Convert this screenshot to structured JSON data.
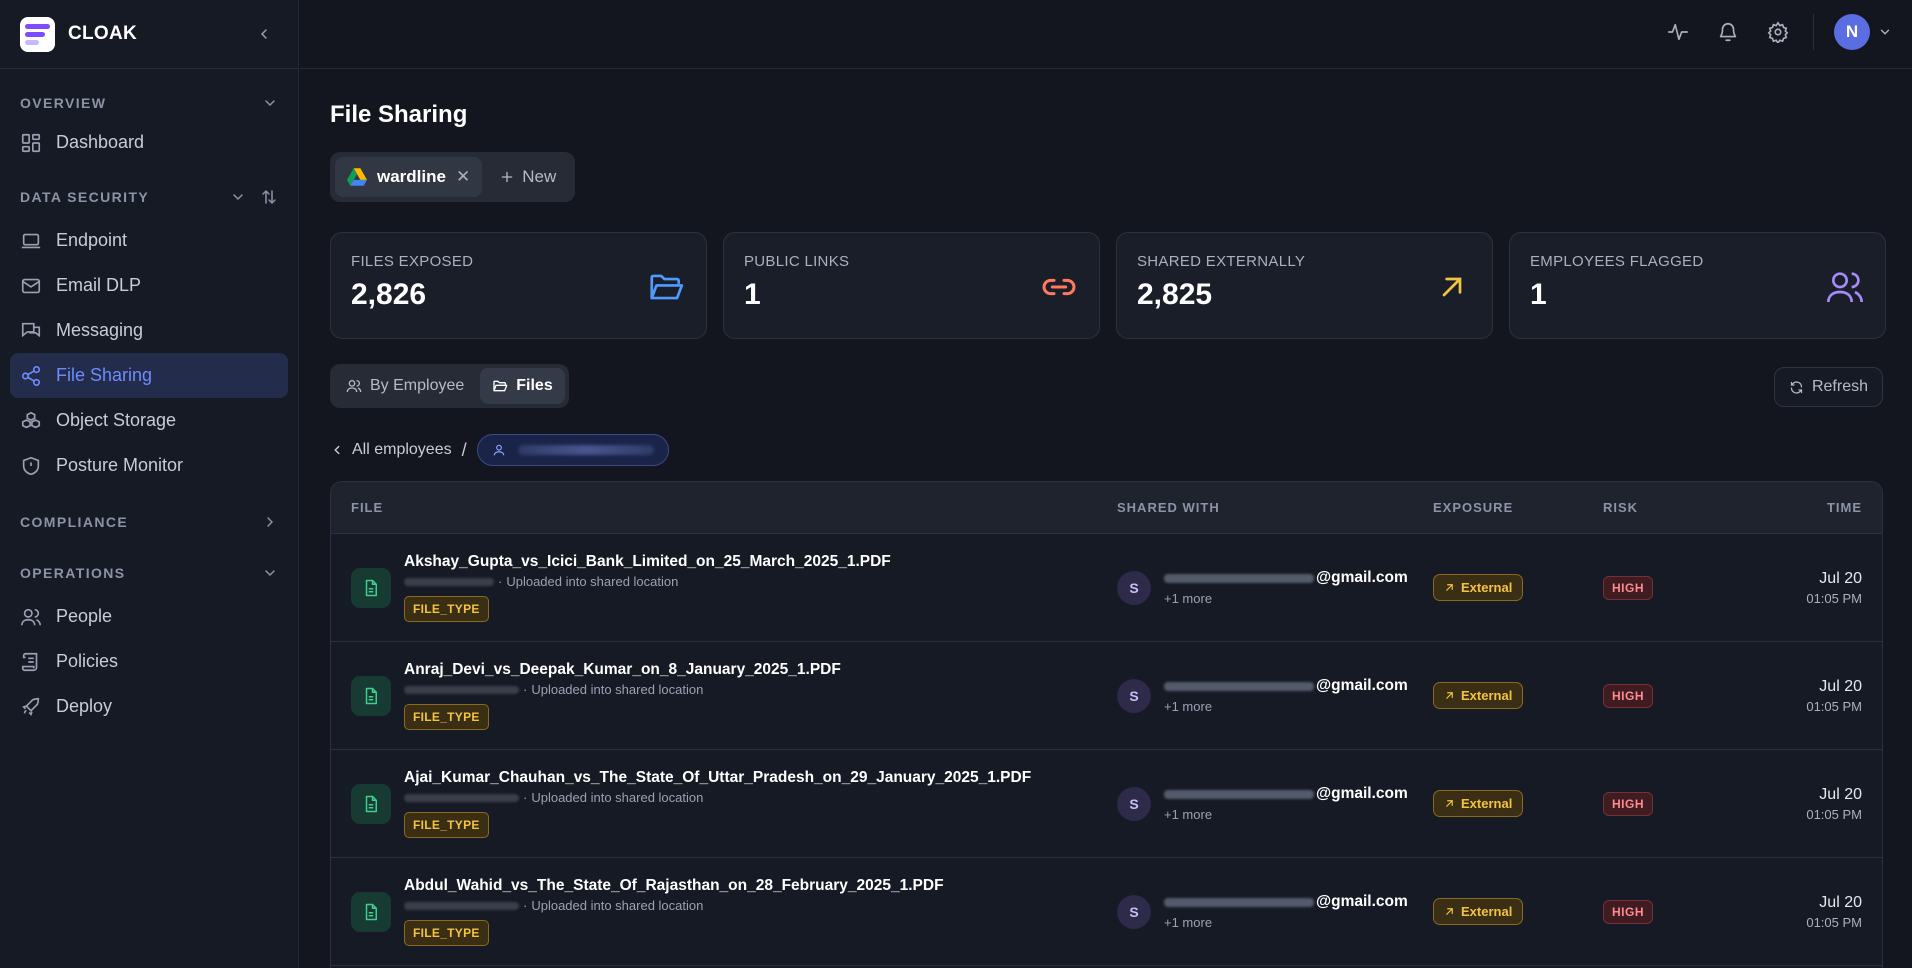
{
  "brand": {
    "name": "CLOAK"
  },
  "colors": {
    "accent": "#6d8bff",
    "background": "#13161f",
    "sidebar": "#161a24",
    "warning": "#f5c342",
    "danger": "#ff8a8f",
    "success": "#3ecf8e"
  },
  "sidebar": {
    "sections": [
      {
        "title": "OVERVIEW",
        "items": [
          {
            "label": "Dashboard",
            "icon": "dashboard-icon"
          }
        ]
      },
      {
        "title": "DATA SECURITY",
        "items": [
          {
            "label": "Endpoint",
            "icon": "laptop-icon"
          },
          {
            "label": "Email DLP",
            "icon": "mail-icon"
          },
          {
            "label": "Messaging",
            "icon": "messages-icon"
          },
          {
            "label": "File Sharing",
            "icon": "share-icon",
            "active": true
          },
          {
            "label": "Object Storage",
            "icon": "boxes-icon"
          },
          {
            "label": "Posture Monitor",
            "icon": "shield-icon"
          }
        ]
      },
      {
        "title": "COMPLIANCE",
        "items": []
      },
      {
        "title": "OPERATIONS",
        "items": [
          {
            "label": "People",
            "icon": "users-icon"
          },
          {
            "label": "Policies",
            "icon": "scroll-icon"
          },
          {
            "label": "Deploy",
            "icon": "rocket-icon"
          }
        ]
      }
    ]
  },
  "topbar": {
    "avatar_initial": "N"
  },
  "page": {
    "title": "File Sharing",
    "workspace": {
      "name": "wardline",
      "close": "✕",
      "new_label": "New"
    }
  },
  "stats": [
    {
      "label": "FILES EXPOSED",
      "value": "2,826",
      "icon": "folder-open-icon",
      "color": "#4f9bff"
    },
    {
      "label": "PUBLIC LINKS",
      "value": "1",
      "icon": "link-icon",
      "color": "#ff7a5c"
    },
    {
      "label": "SHARED EXTERNALLY",
      "value": "2,825",
      "icon": "arrow-up-right-icon",
      "color": "#f5c342"
    },
    {
      "label": "EMPLOYEES FLAGGED",
      "value": "1",
      "icon": "users-icon",
      "color": "#a78bfa"
    }
  ],
  "view_toggle": {
    "by_employee": "By Employee",
    "files": "Files",
    "active": "Files"
  },
  "refresh_label": "Refresh",
  "breadcrumb": {
    "back_label": "All employees",
    "separator": "/"
  },
  "table": {
    "columns": {
      "file": "FILE",
      "shared_with": "SHARED WITH",
      "exposure": "EXPOSURE",
      "risk": "RISK",
      "time": "TIME"
    },
    "rows": [
      {
        "file": "Akshay_Gupta_vs_Icici_Bank_Limited_on_25_March_2025_1.PDF",
        "action": "Uploaded into shared location",
        "type": "FILE_TYPE",
        "avatar": "S",
        "email_domain": "@gmail.com",
        "more": "+1 more",
        "exposure": "External",
        "risk": "HIGH",
        "date": "Jul 20",
        "time": "01:05 PM"
      },
      {
        "file": "Anraj_Devi_vs_Deepak_Kumar_on_8_January_2025_1.PDF",
        "action": "Uploaded into shared location",
        "type": "FILE_TYPE",
        "avatar": "S",
        "email_domain": "@gmail.com",
        "more": "+1 more",
        "exposure": "External",
        "risk": "HIGH",
        "date": "Jul 20",
        "time": "01:05 PM"
      },
      {
        "file": "Ajai_Kumar_Chauhan_vs_The_State_Of_Uttar_Pradesh_on_29_January_2025_1.PDF",
        "action": "Uploaded into shared location",
        "type": "FILE_TYPE",
        "avatar": "S",
        "email_domain": "@gmail.com",
        "more": "+1 more",
        "exposure": "External",
        "risk": "HIGH",
        "date": "Jul 20",
        "time": "01:05 PM"
      },
      {
        "file": "Abdul_Wahid_vs_The_State_Of_Rajasthan_on_28_February_2025_1.PDF",
        "action": "Uploaded into shared location",
        "type": "FILE_TYPE",
        "avatar": "S",
        "email_domain": "@gmail.com",
        "more": "+1 more",
        "exposure": "External",
        "risk": "HIGH",
        "date": "Jul 20",
        "time": "01:05 PM"
      }
    ]
  }
}
